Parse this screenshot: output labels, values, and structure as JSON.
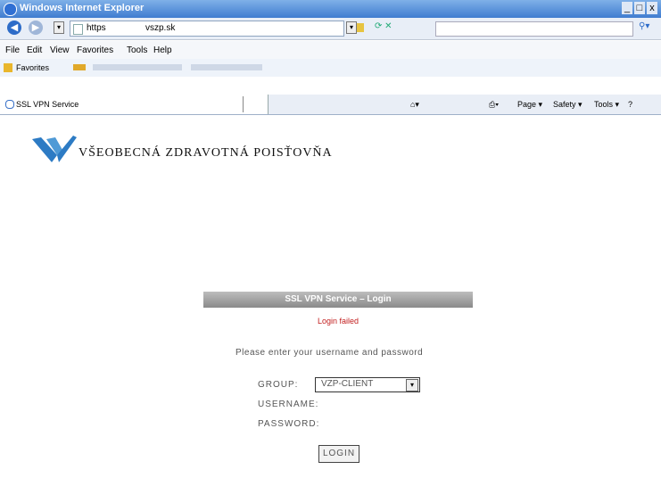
{
  "window": {
    "title": "Windows Internet Explorer",
    "min": "_",
    "max": "□",
    "close": "x"
  },
  "address": {
    "protocol": "https",
    "host": "vszp.sk",
    "search_placeholder": ""
  },
  "menu": [
    "File",
    "Edit",
    "View",
    "Favorites",
    "Tools",
    "Help"
  ],
  "favorites": {
    "label": "Favorites"
  },
  "tab": {
    "title": "SSL VPN Service"
  },
  "commands": {
    "page": "Page ▾",
    "safety": "Safety ▾",
    "tools": "Tools ▾",
    "help": "?"
  },
  "page": {
    "brand": "VŠEOBECNÁ ZDRAVOTNÁ POISŤOVŇA",
    "login_header": "SSL VPN Service – Login",
    "login_status": "Login failed",
    "prompt": "Please enter your username and password",
    "group_label": "GROUP:",
    "group_value": "VZP-CLIENT",
    "username_label": "USERNAME:",
    "password_label": "PASSWORD:",
    "login_button": "LOGIN"
  },
  "colors": {
    "ie_blue": "#3f7cd0",
    "error_red": "#c21e1e",
    "logo_blue": "#2d7bc4"
  }
}
